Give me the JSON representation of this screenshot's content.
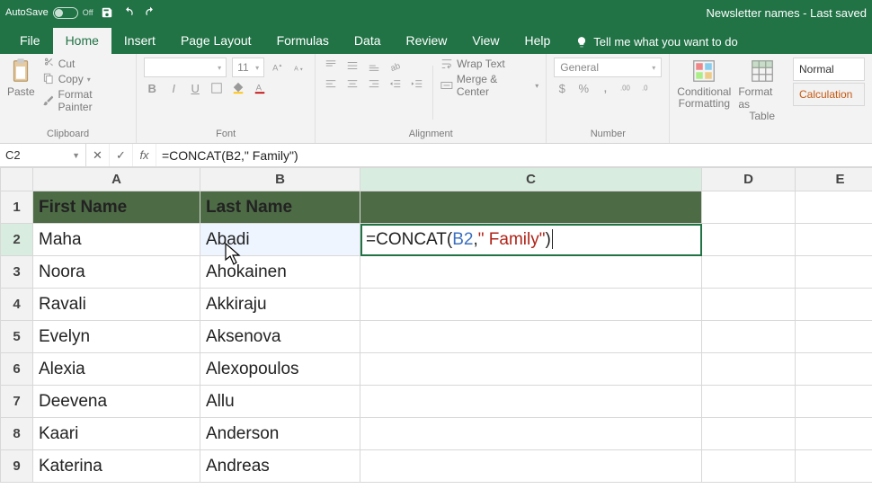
{
  "titleBar": {
    "autosave": "AutoSave",
    "autosaveState": "Off",
    "docTitle": "Newsletter names  -  Last saved "
  },
  "tabs": {
    "file": "File",
    "home": "Home",
    "insert": "Insert",
    "pageLayout": "Page Layout",
    "formulas": "Formulas",
    "data": "Data",
    "review": "Review",
    "view": "View",
    "help": "Help",
    "tellMe": "Tell me what you want to do"
  },
  "ribbon": {
    "clipboard": {
      "paste": "Paste",
      "cut": "Cut",
      "copy": "Copy",
      "formatPainter": "Format Painter",
      "label": "Clipboard"
    },
    "font": {
      "name": "",
      "size": "11",
      "label": "Font"
    },
    "alignment": {
      "wrapText": "Wrap Text",
      "mergeCenter": "Merge & Center",
      "label": "Alignment"
    },
    "number": {
      "format": "General",
      "label": "Number"
    },
    "styles": {
      "conditional": "Conditional",
      "conditional2": "Formatting",
      "formatAs": "Format as",
      "formatAs2": "Table",
      "normal": "Normal",
      "calculation": "Calculation"
    }
  },
  "nameBox": {
    "ref": "C2",
    "formula": "=CONCAT(B2,\" Family\")"
  },
  "columns": [
    "A",
    "B",
    "C",
    "D",
    "E"
  ],
  "headers": {
    "a": "First Name",
    "b": "Last Name"
  },
  "rows": [
    {
      "n": "1"
    },
    {
      "n": "2",
      "a": "Maha",
      "b": "Abadi"
    },
    {
      "n": "3",
      "a": "Noora",
      "b": "Ahokainen"
    },
    {
      "n": "4",
      "a": "Ravali",
      "b": "Akkiraju"
    },
    {
      "n": "5",
      "a": "Evelyn",
      "b": "Aksenova"
    },
    {
      "n": "6",
      "a": "Alexia",
      "b": "Alexopoulos"
    },
    {
      "n": "7",
      "a": "Deevena",
      "b": "Allu"
    },
    {
      "n": "8",
      "a": "Kaari",
      "b": "Anderson"
    },
    {
      "n": "9",
      "a": "Katerina",
      "b": "Andreas"
    }
  ],
  "cellFormula": {
    "prefix": "=CONCAT(",
    "ref": "B2",
    "mid": ",",
    "str": "\" Family\"",
    "suffix": ")"
  }
}
